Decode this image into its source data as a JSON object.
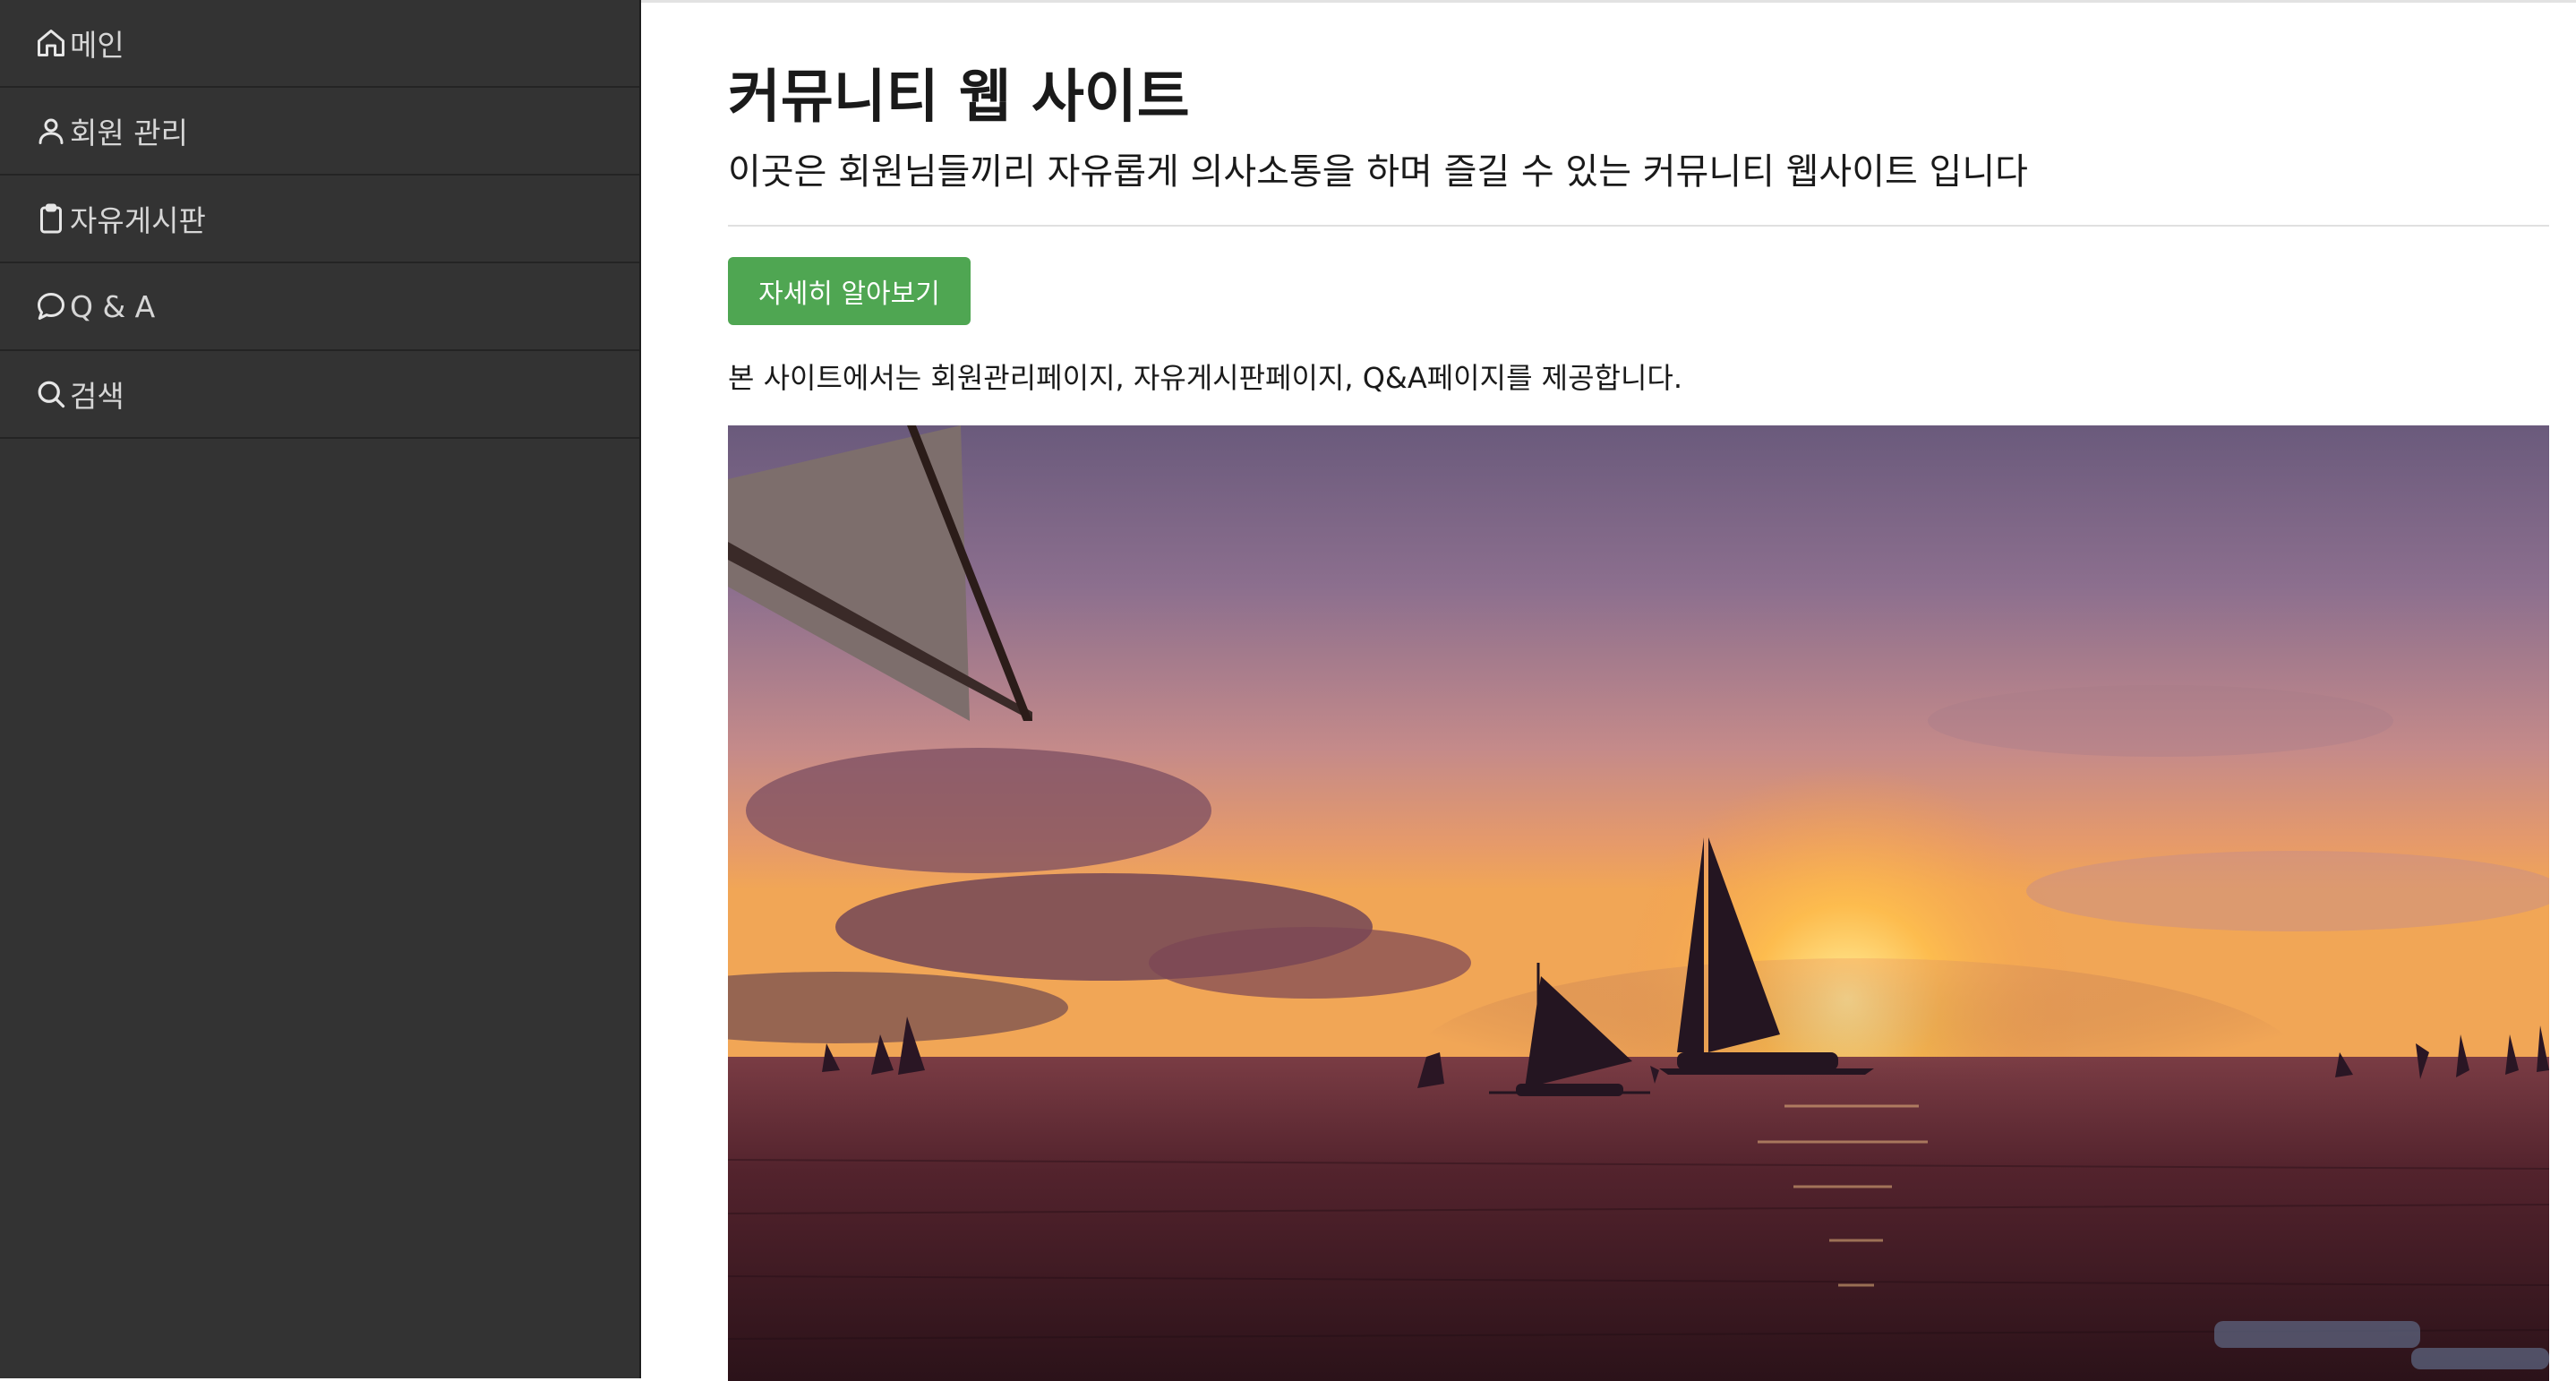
{
  "sidebar": {
    "items": [
      {
        "label": "메인",
        "icon": "home-icon"
      },
      {
        "label": "회원 관리",
        "icon": "user-icon"
      },
      {
        "label": "자유게시판",
        "icon": "clipboard-icon"
      },
      {
        "label": "Q & A",
        "icon": "chat-bubble-icon"
      },
      {
        "label": "검색",
        "icon": "search-icon"
      }
    ]
  },
  "main": {
    "title": "커뮤니티 웹 사이트",
    "subtitle": "이곳은 회원님들끼리 자유롭게 의사소통을 하며 즐길 수 있는 커뮤니티 웹사이트 입니다",
    "button_label": "자세히 알아보기",
    "description": "본 사이트에서는 회원관리페이지, 자유게시판페이지, Q&A페이지를 제공합니다."
  },
  "colors": {
    "sidebar_bg": "#333333",
    "sidebar_text": "#d6d6d6",
    "button_bg": "#4fa652",
    "button_text": "#ffffff"
  }
}
